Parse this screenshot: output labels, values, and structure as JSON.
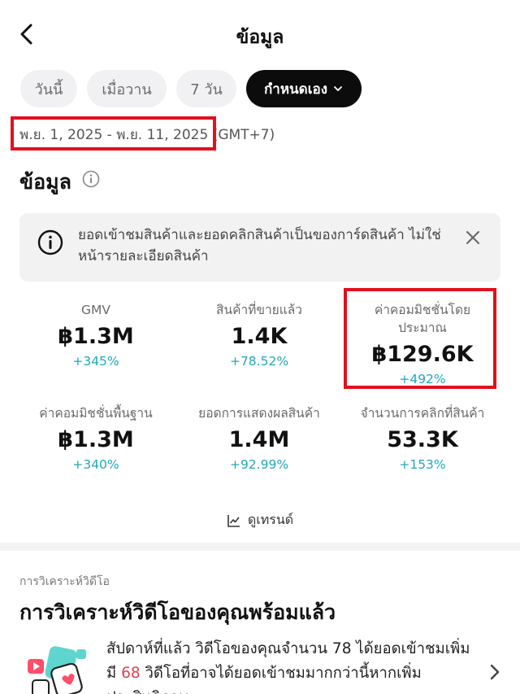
{
  "header": {
    "title": "ข้อมูล",
    "back_icon": "chevron-left-icon"
  },
  "filters": {
    "chips": [
      "วันนี้",
      "เมื่อวาน",
      "7 วัน"
    ],
    "custom_label": "กำหนดเอง",
    "custom_chevron": "⌄"
  },
  "date_range": "พ.ย. 1, 2025 - พ.ย. 11, 2025 (GMT+7)",
  "section": {
    "title": "ข้อมูล",
    "info_icon": "info-circle-icon"
  },
  "notice": {
    "text": "ยอดเข้าชมสินค้าและยอดคลิกสินค้าเป็นของการ์ดสินค้า ไม่ใช่หน้ารายละเอียดสินค้า",
    "icon": "info-circle-icon",
    "close_icon": "close-icon"
  },
  "metrics": [
    {
      "label": "GMV",
      "value": "฿1.3M",
      "change": "+345%"
    },
    {
      "label": "สินค้าที่ขายแล้ว",
      "value": "1.4K",
      "change": "+78.52%"
    },
    {
      "label": "ค่าคอมมิชชั่นโดยประมาณ",
      "value": "฿129.6K",
      "change": "+492%"
    },
    {
      "label": "ค่าคอมมิชชั่นพื้นฐาน",
      "value": "฿1.3M",
      "change": "+340%"
    },
    {
      "label": "ยอดการแสดงผลสินค้า",
      "value": "1.4M",
      "change": "+92.99%"
    },
    {
      "label": "จำนวนการคลิกที่สินค้า",
      "value": "53.3K",
      "change": "+153%"
    }
  ],
  "trend": {
    "label": "ดูเทรนด์",
    "icon": "line-chart-icon"
  },
  "video_analysis": {
    "small_label": "การวิเคราะห์วิดีโอ",
    "title": "การวิเคราะห์วิดีโอของคุณพร้อมแล้ว",
    "text_before": "สัปดาห์ที่แล้ว วิดีโอของคุณจำนวน 78 ได้ยอดเข้าชมเพิ่ม มี ",
    "highlight": "68",
    "text_after": " วิดีโอที่อาจได้ยอดเข้าชมมากกว่านี้หากเพิ่มประสิทธิภาพ",
    "highlight_color": "#e0424e",
    "illustration": "video-illustration-icon",
    "chevron": "chevron-right-icon"
  },
  "colors": {
    "accent_change": "#22a7b8",
    "highlight_box": "#e3101d"
  }
}
